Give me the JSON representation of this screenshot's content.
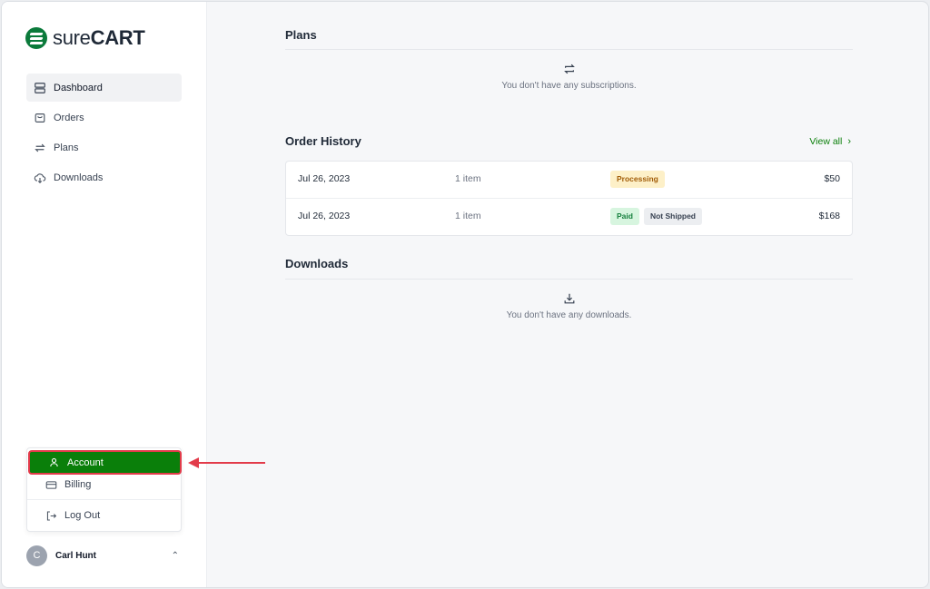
{
  "brand": {
    "name_light": "sure",
    "name_bold": "CART",
    "accent": "#0a7f0a"
  },
  "sidebar": {
    "items": [
      {
        "label": "Dashboard",
        "icon": "dashboard-icon",
        "active": true
      },
      {
        "label": "Orders",
        "icon": "shopping-bag-icon"
      },
      {
        "label": "Plans",
        "icon": "repeat-icon"
      },
      {
        "label": "Downloads",
        "icon": "cloud-download-icon"
      }
    ]
  },
  "account_menu": {
    "items": [
      {
        "label": "Account",
        "icon": "user-icon",
        "highlighted": true
      },
      {
        "label": "Billing",
        "icon": "credit-card-icon"
      },
      {
        "label": "Log Out",
        "icon": "logout-icon"
      }
    ]
  },
  "user": {
    "initial": "C",
    "name": "Carl Hunt"
  },
  "plans": {
    "title": "Plans",
    "empty_text": "You don't have any subscriptions."
  },
  "order_history": {
    "title": "Order History",
    "view_all_label": "View all",
    "orders": [
      {
        "date": "Jul 26, 2023",
        "items": "1 item",
        "badges": [
          "Processing"
        ],
        "amount": "$50"
      },
      {
        "date": "Jul 26, 2023",
        "items": "1 item",
        "badges": [
          "Paid",
          "Not Shipped"
        ],
        "amount": "$168"
      }
    ]
  },
  "downloads": {
    "title": "Downloads",
    "empty_text": "You don't have any downloads."
  }
}
